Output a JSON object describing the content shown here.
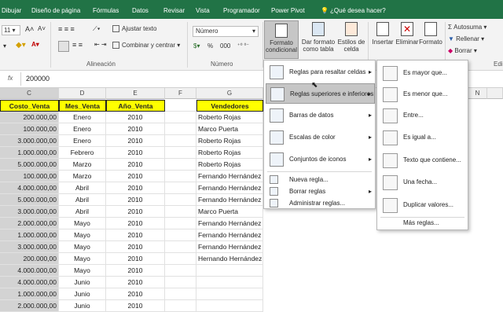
{
  "tabs": {
    "dibujar": "Dibujar",
    "diseno": "Diseño de página",
    "formulas": "Fórmulas",
    "datos": "Datos",
    "revisar": "Revisar",
    "vista": "Vista",
    "programador": "Programador",
    "powerpivot": "Power Pivot",
    "tellme": "¿Qué desea hacer?"
  },
  "ribbon": {
    "font_size": "11",
    "wrap_text": "Ajustar texto",
    "merge_center": "Combinar y centrar",
    "alignment_group": "Alineación",
    "number_format": "Número",
    "number_group": "Número",
    "cond_format_1": "Formato",
    "cond_format_2": "condicional",
    "format_table_1": "Dar formato",
    "format_table_2": "como tabla",
    "cell_styles_1": "Estilos de",
    "cell_styles_2": "celda",
    "insert": "Insertar",
    "delete": "Eliminar",
    "format": "Formato",
    "autosum": "Autosuma",
    "fill": "Rellenar",
    "clear": "Borrar",
    "edit_group": "Edi",
    "percent": "%",
    "thousands": "000"
  },
  "formula_bar": {
    "fx": "fx",
    "value": "200000"
  },
  "columns": {
    "c": "C",
    "d": "D",
    "e": "E",
    "f": "F",
    "g": "G",
    "h": "H",
    "n": "N"
  },
  "headers": {
    "costo": "Costo_Venta",
    "mes": "Mes_Venta",
    "anio": "Año_Venta",
    "vendedores": "Vendedores"
  },
  "rows": [
    [
      "200.000,00",
      "Enero",
      "2010",
      "Roberto Rojas"
    ],
    [
      "100.000,00",
      "Enero",
      "2010",
      "Marco Puerta"
    ],
    [
      "3.000.000,00",
      "Enero",
      "2010",
      "Roberto Rojas"
    ],
    [
      "1.000.000,00",
      "Febrero",
      "2010",
      "Roberto Rojas"
    ],
    [
      "5.000.000,00",
      "Marzo",
      "2010",
      "Roberto Rojas"
    ],
    [
      "100.000,00",
      "Marzo",
      "2010",
      "Fernando Hernández"
    ],
    [
      "4.000.000,00",
      "Abril",
      "2010",
      "Fernando Hernández"
    ],
    [
      "5.000.000,00",
      "Abril",
      "2010",
      "Fernando Hernández"
    ],
    [
      "3.000.000,00",
      "Abril",
      "2010",
      "Marco Puerta"
    ],
    [
      "2.000.000,00",
      "Mayo",
      "2010",
      "Fernando Hernández"
    ],
    [
      "1.000.000,00",
      "Mayo",
      "2010",
      "Fernando Hernández"
    ],
    [
      "3.000.000,00",
      "Mayo",
      "2010",
      "Fernando Hernández"
    ],
    [
      "200.000,00",
      "Mayo",
      "2010",
      "Hernando Hernández"
    ],
    [
      "4.000.000,00",
      "Mayo",
      "2010",
      ""
    ],
    [
      "4.000.000,00",
      "Junio",
      "2010",
      ""
    ],
    [
      "1.000.000,00",
      "Junio",
      "2010",
      ""
    ],
    [
      "2.000.000,00",
      "Junio",
      "2010",
      ""
    ]
  ],
  "menu1": {
    "resaltar": "Reglas para resaltar celdas",
    "superiores": "Reglas superiores e inferiores",
    "barras": "Barras de datos",
    "escalas": "Escalas de color",
    "iconos": "Conjuntos de iconos",
    "nueva": "Nueva regla...",
    "borrar": "Borrar reglas",
    "administrar": "Administrar reglas..."
  },
  "menu2": {
    "mayor": "Es mayor que...",
    "menor": "Es menor que...",
    "entre": "Entre...",
    "igual": "Es igual a...",
    "texto": "Texto que contiene...",
    "fecha": "Una fecha...",
    "duplicar": "Duplicar valores...",
    "mas": "Más reglas..."
  },
  "colors": {
    "accent": "#217346",
    "header_fill": "#ffff00",
    "selection": "#d3d3d3"
  }
}
